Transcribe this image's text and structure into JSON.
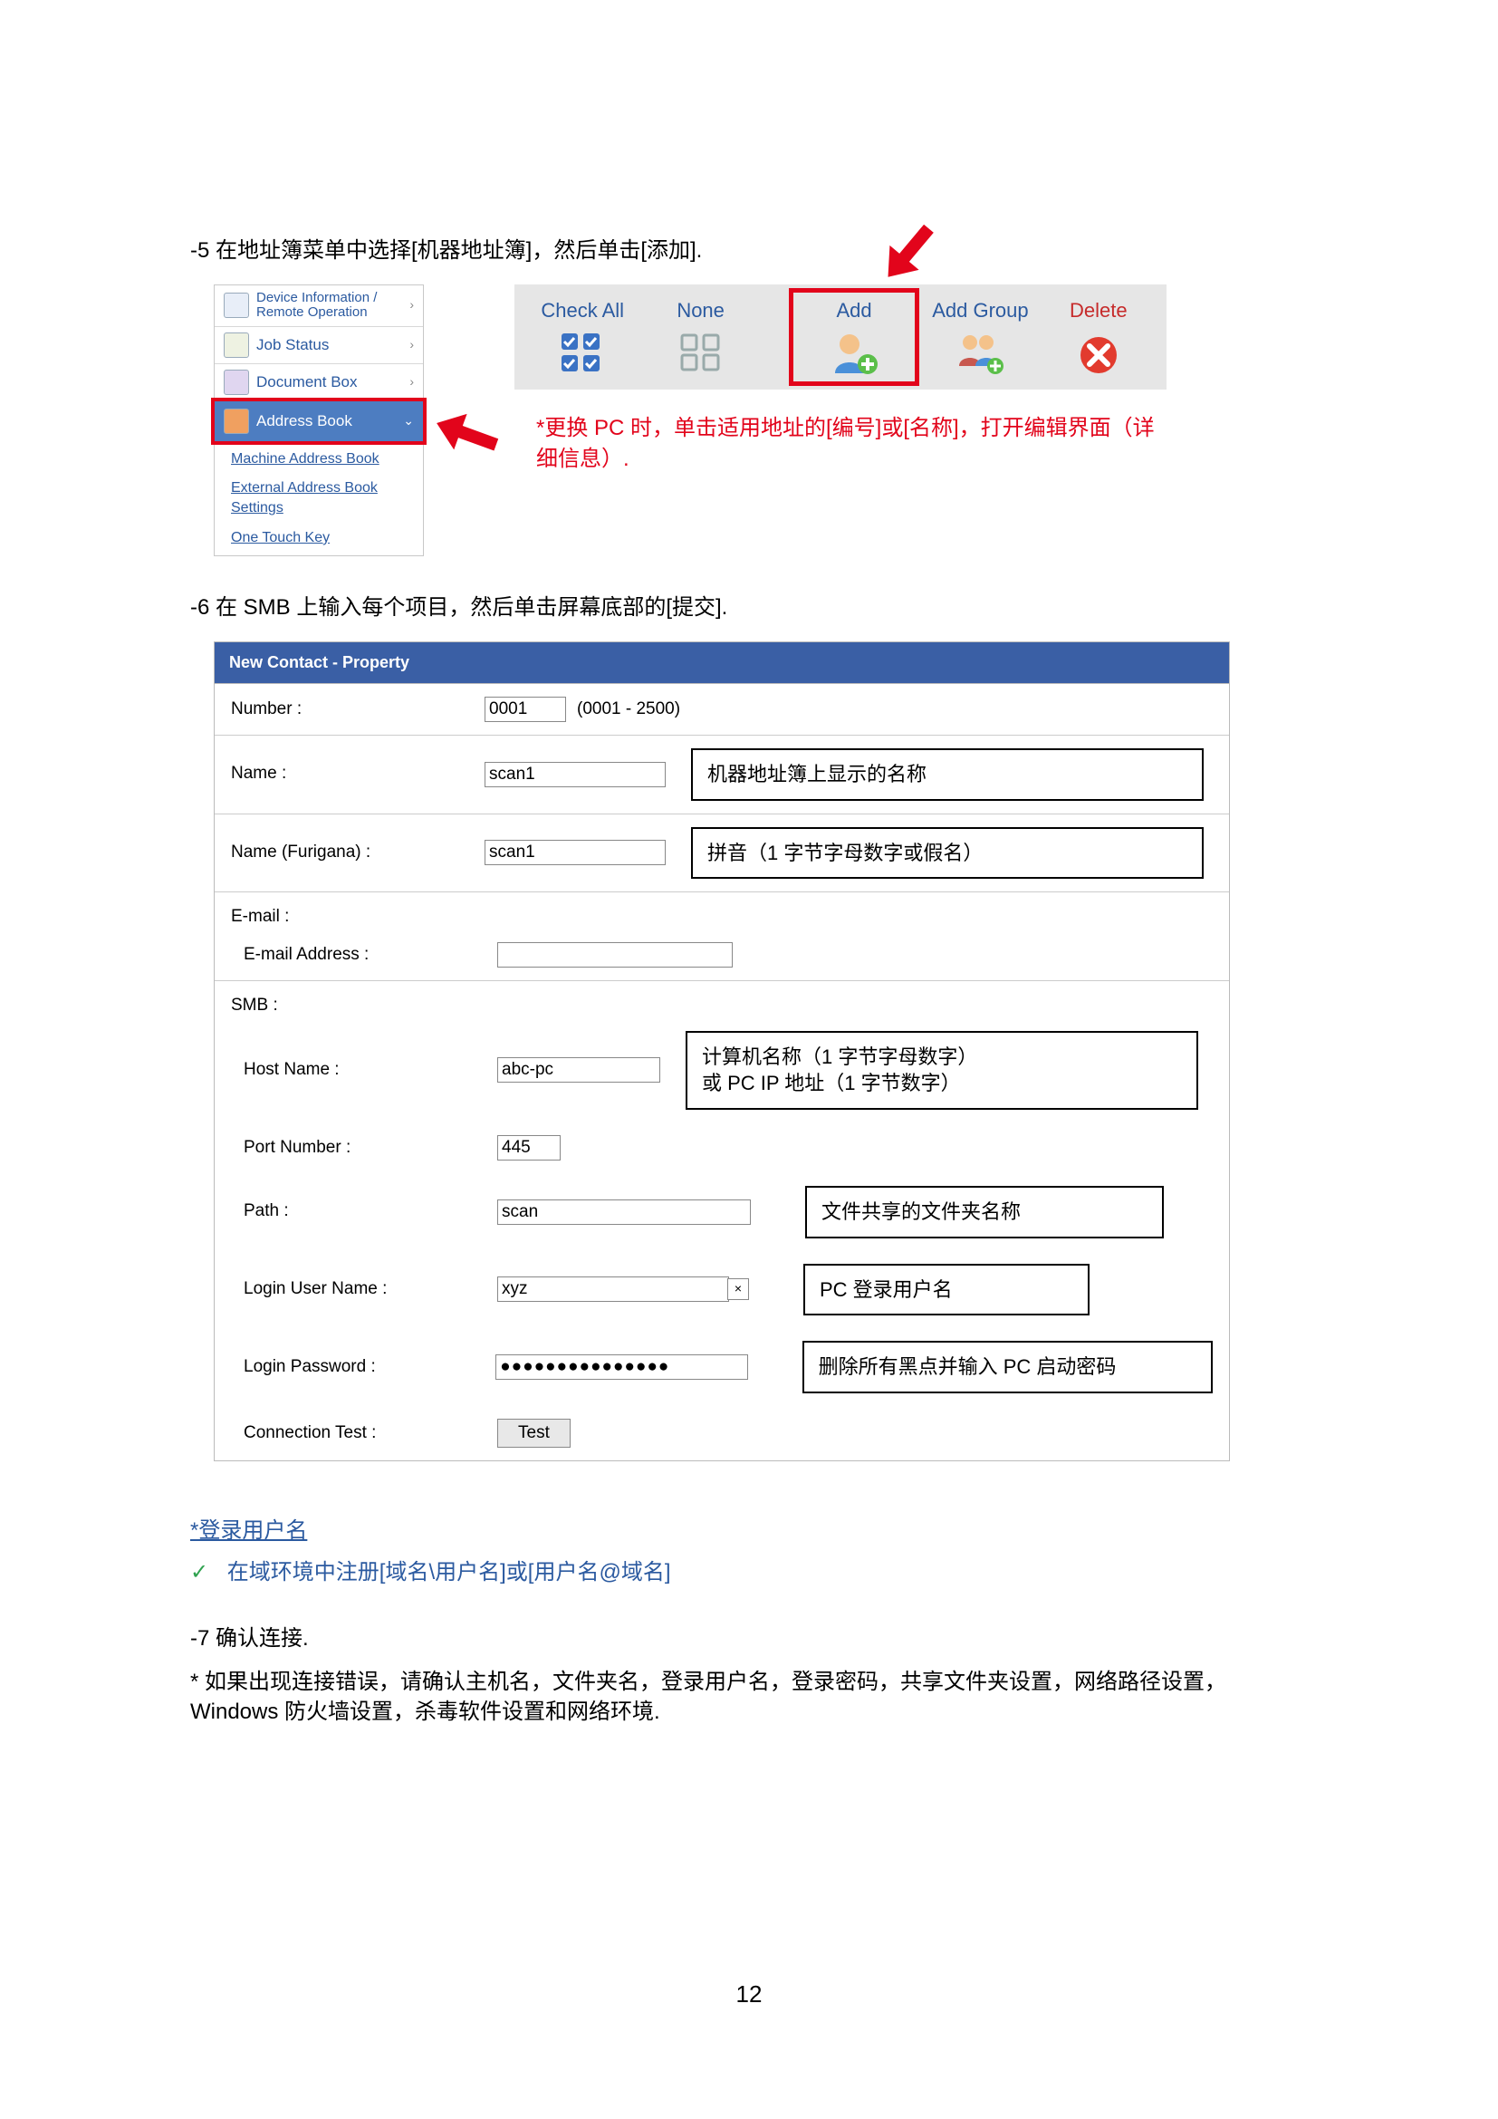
{
  "steps": {
    "s5": "-5 在地址簿菜单中选择[机器地址簿]，然后单击[添加].",
    "s5_note": "*更换 PC 时，单击适用地址的[编号]或[名称]，打开编辑界面（详细信息）.",
    "s6": "-6 在 SMB 上输入每个项目，然后单击屏幕底部的[提交].",
    "s7_head": "-7   确认连接.",
    "s7_body": "* 如果出现连接错误，请确认主机名，文件夹名，登录用户名，登录密码，共享文件夹设置，网络路径设置，Windows 防火墙设置，杀毒软件设置和网络环境."
  },
  "sidebar": {
    "items": [
      {
        "label": "Device Information / Remote Operation"
      },
      {
        "label": "Job Status"
      },
      {
        "label": "Document Box"
      },
      {
        "label": "Address Book"
      }
    ],
    "subs": [
      "Machine Address Book",
      "External Address Book Settings",
      "One Touch Key"
    ]
  },
  "toolbar": {
    "checkall": "Check All",
    "none": "None",
    "add": "Add",
    "addgroup": "Add Group",
    "delete": "Delete"
  },
  "prop": {
    "header": "New Contact - Property",
    "number_label": "Number :",
    "number_value": "0001",
    "number_range": "(0001 - 2500)",
    "name_label": "Name :",
    "name_value": "scan1",
    "name_annot": "机器地址簿上显示的名称",
    "furi_label": "Name (Furigana) :",
    "furi_value": "scan1",
    "furi_annot": "拼音（1 字节字母数字或假名）",
    "email_label": "E-mail :",
    "emailaddr_label": "E-mail Address :",
    "emailaddr_value": "",
    "smb_label": "SMB :",
    "host_label": "Host Name :",
    "host_value": "abc-pc",
    "host_annot": "计算机名称（1 字节字母数字）\n或 PC IP 地址（1 字节数字）",
    "port_label": "Port Number :",
    "port_value": "445",
    "path_label": "Path :",
    "path_value": "scan",
    "path_annot": "文件共享的文件夹名称",
    "user_label": "Login User Name :",
    "user_value": "xyz",
    "user_annot": "PC 登录用户名",
    "pass_label": "Login Password :",
    "pass_value": "●●●●●●●●●●●●●●●",
    "pass_annot": "删除所有黑点并输入 PC 启动密码",
    "test_label": "Connection Test :",
    "test_btn": "Test"
  },
  "notes": {
    "login_title": "*登录用户名",
    "login_body": "在域环境中注册[域名\\用户名]或[用户名@域名]"
  },
  "page_number": "12"
}
